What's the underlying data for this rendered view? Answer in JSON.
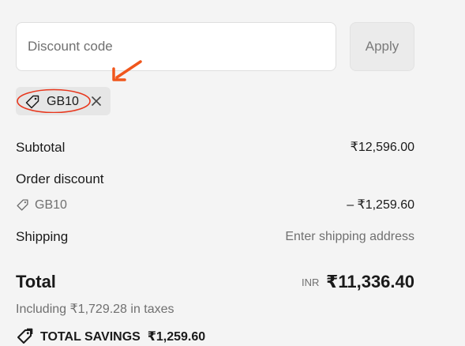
{
  "discount": {
    "placeholder": "Discount code",
    "value": "",
    "apply_label": "Apply"
  },
  "applied_code": {
    "label": "GB10",
    "icon": "tag-icon",
    "remove_icon": "close-icon"
  },
  "summary": {
    "subtotal_label": "Subtotal",
    "subtotal_value": "₹12,596.00",
    "order_discount_label": "Order discount",
    "discount_code": "GB10",
    "discount_value": "– ₹1,259.60",
    "shipping_label": "Shipping",
    "shipping_value": "Enter shipping address"
  },
  "total": {
    "label": "Total",
    "currency": "INR",
    "amount": "₹11,336.40",
    "tax_note": "Including ₹1,729.28 in taxes"
  },
  "savings": {
    "label": "TOTAL SAVINGS",
    "amount": "₹1,259.60"
  },
  "colors": {
    "annotation": "#e8361c",
    "arrow": "#f0561c",
    "page_background": "#f4f4f4"
  }
}
